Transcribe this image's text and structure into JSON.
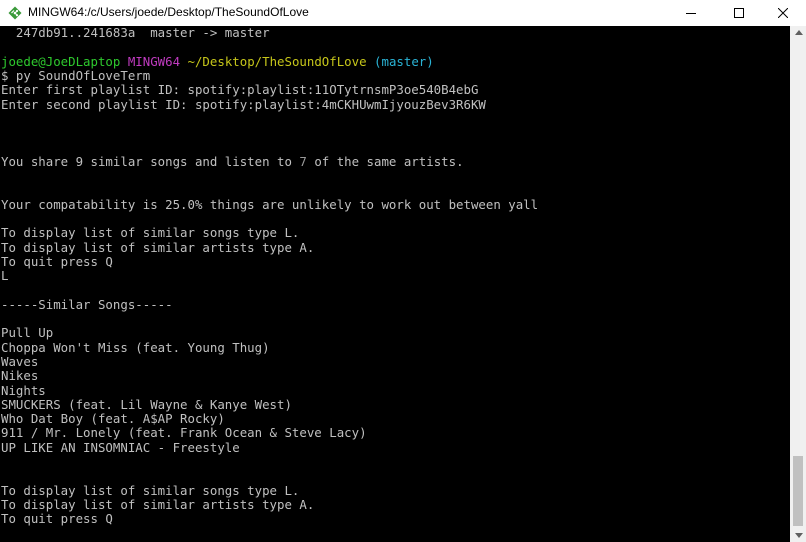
{
  "window": {
    "title": "MINGW64:/c/Users/joede/Desktop/TheSoundOfLove"
  },
  "terminal": {
    "git_line": "  247db91..241683a  master -> master",
    "prompt": {
      "user_host": "joede@JoeDLaptop",
      "shell": "MINGW64",
      "path": "~/Desktop/TheSoundOfLove",
      "branch": "(master)"
    },
    "command": "$ py SoundOfLoveTerm",
    "input1": "Enter first playlist ID: spotify:playlist:11OTytrnsmP3oe540B4ebG",
    "input2": "Enter second playlist ID: spotify:playlist:4mCKHUwmIjyouzBev3R6KW",
    "share": {
      "before": "You share 9 similar songs and listen to ",
      "count": "7",
      "after": " of the same artists."
    },
    "compat": "Your compatability is 25.0% things are unlikely to work out between yall",
    "menu": [
      "To display list of similar songs type L.",
      "To display list of similar artists type A.",
      "To quit press Q"
    ],
    "user_input": "L",
    "section_header": "-----Similar Songs-----",
    "songs": [
      "Pull Up",
      "Choppa Won't Miss (feat. Young Thug)",
      "Waves",
      "Nikes",
      "Nights",
      "SMUCKERS (feat. Lil Wayne & Kanye West)",
      "Who Dat Boy (feat. A$AP Rocky)",
      "911 / Mr. Lonely (feat. Frank Ocean & Steve Lacy)",
      "UP LIKE AN INSOMNIAC - Freestyle"
    ],
    "menu2": [
      "To display list of similar songs type L.",
      "To display list of similar artists type A.",
      "To quit press Q"
    ]
  }
}
